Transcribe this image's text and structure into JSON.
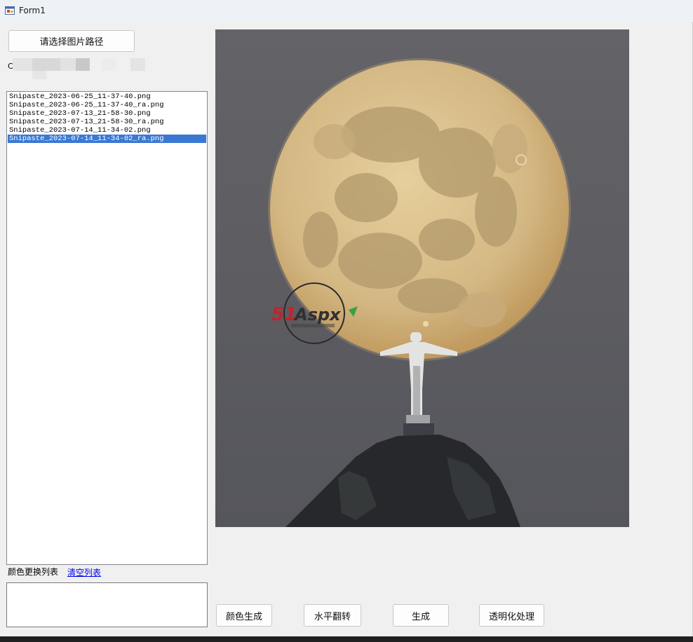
{
  "window": {
    "title": "Form1"
  },
  "controls": {
    "select_path_label": "请选择图片路径",
    "path_prefix": "C",
    "color_list_label": "颜色更换列表",
    "clear_list_label": "清空列表",
    "color_generate_label": "颜色生成",
    "flip_label": "水平翻转",
    "generate_label": "生成",
    "transparent_label": "透明化处理"
  },
  "files": [
    "Snipaste_2023-06-25_11-37-40.png",
    "Snipaste_2023-06-25_11-37-40_ra.png",
    "Snipaste_2023-07-13_21-58-30.png",
    "Snipaste_2023-07-13_21-58-30_ra.png",
    "Snipaste_2023-07-14_11-34-02.png",
    "Snipaste_2023-07-14_11-34-02_ra.png"
  ],
  "selected_file_index": 5,
  "watermark": {
    "brand_number": "51",
    "brand_name": "Aspx"
  },
  "colors": {
    "selection": "#3a78d4",
    "link": "#0000ee",
    "sky": "#5f5e62",
    "moon": "#d8bf8a"
  }
}
